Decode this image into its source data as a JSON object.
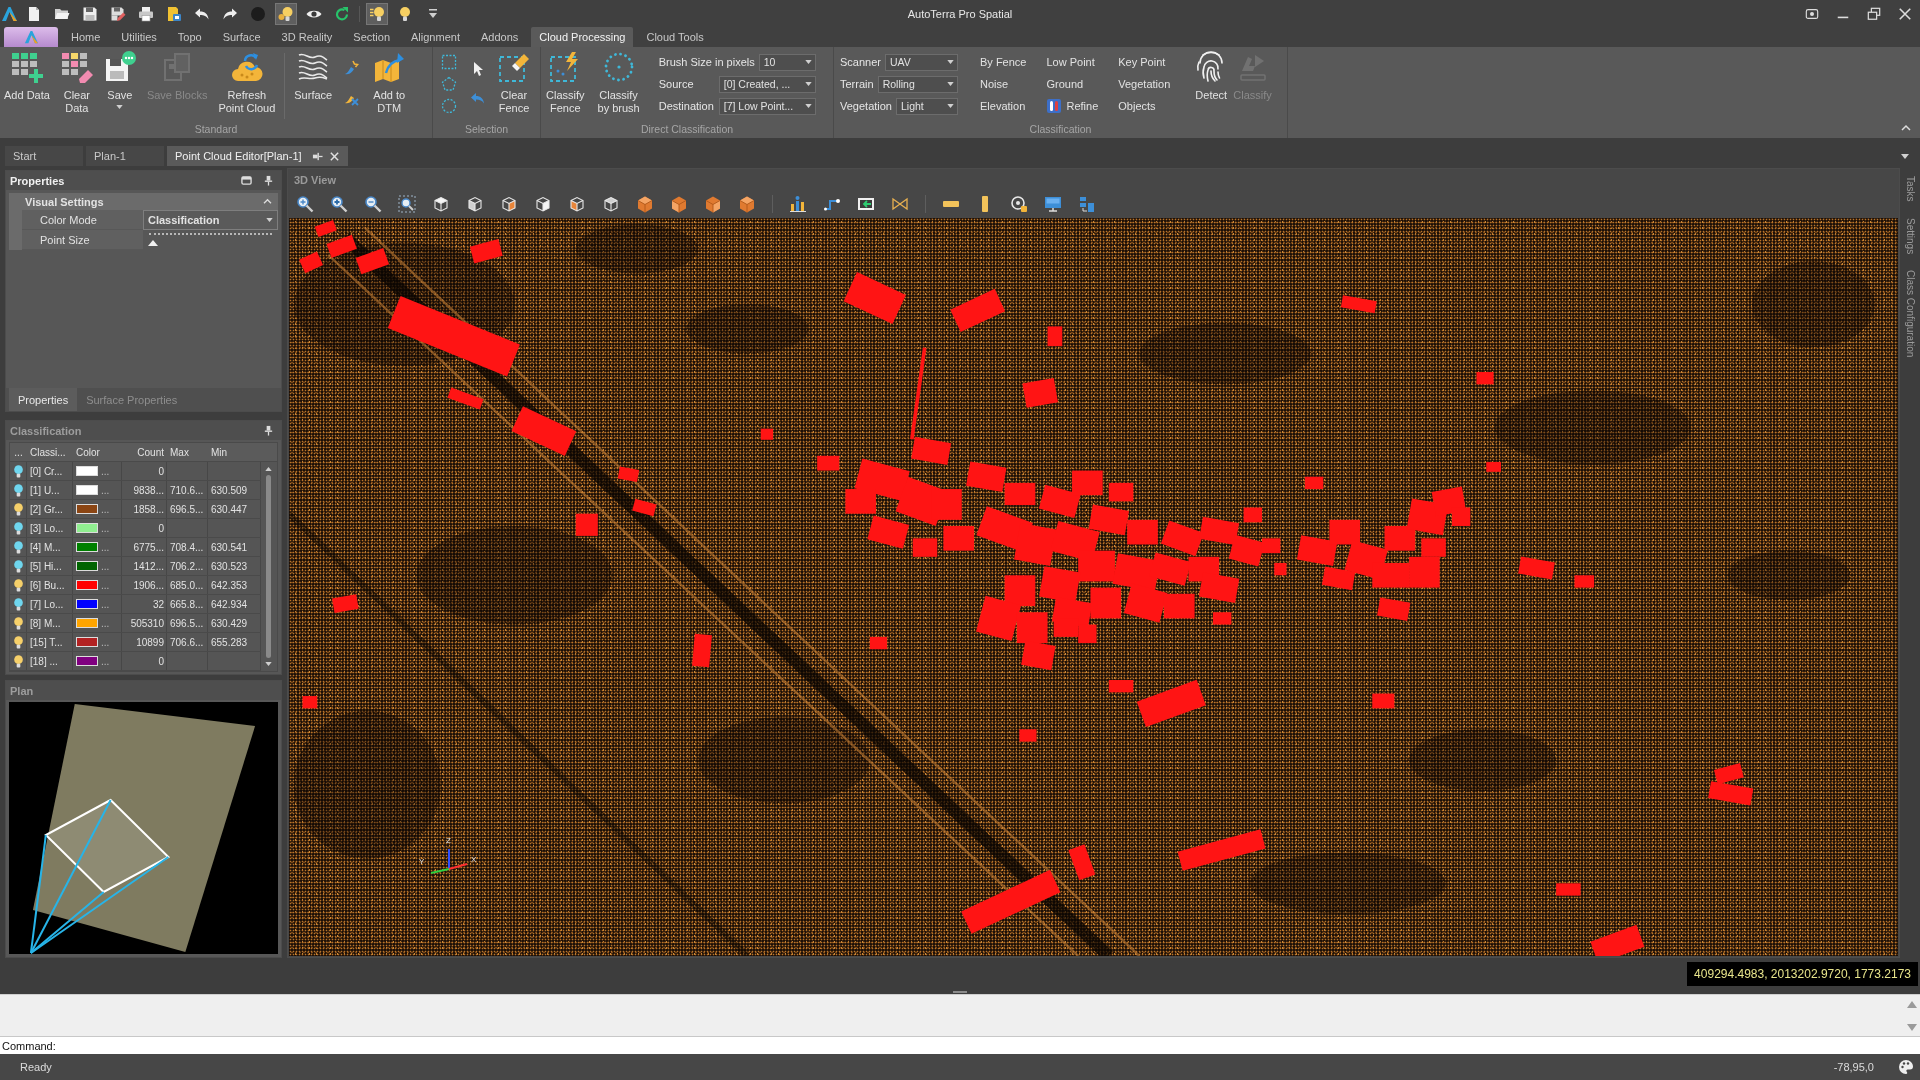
{
  "window": {
    "title": "AutoTerra Pro Spatial"
  },
  "quick_access": [
    {
      "on": false
    },
    {
      "on": false
    },
    {
      "on": false
    },
    {
      "on": false
    },
    {
      "on": false
    },
    {
      "on": false
    },
    {
      "on": false
    },
    {
      "on": false
    },
    {
      "on": false
    },
    {
      "on": true
    },
    {
      "on": false
    },
    {
      "on": false
    },
    {
      "on": true
    },
    {
      "on": false
    }
  ],
  "ribbon": {
    "tabs": [
      {
        "label": "Home",
        "selected": false
      },
      {
        "label": "Utilities",
        "selected": false
      },
      {
        "label": "Topo",
        "selected": false
      },
      {
        "label": "Surface",
        "selected": false
      },
      {
        "label": "3D Reality",
        "selected": false
      },
      {
        "label": "Section",
        "selected": false
      },
      {
        "label": "Alignment",
        "selected": false
      },
      {
        "label": "Addons",
        "selected": false
      },
      {
        "label": "Cloud Processing",
        "selected": true
      },
      {
        "label": "Cloud Tools",
        "selected": false
      }
    ],
    "groups": [
      {
        "title": "Standard",
        "buttons": [
          {
            "label": "Add Data",
            "disabled": false
          },
          {
            "label": "Clear\nData",
            "disabled": false
          },
          {
            "label": "Save",
            "disabled": false
          },
          {
            "label": "Save Blocks",
            "disabled": true
          },
          {
            "label": "Refresh\nPoint Cloud",
            "disabled": false
          },
          {
            "label": "Surface",
            "disabled": false
          },
          {
            "label": "Add to\nDTM",
            "disabled": false
          }
        ]
      },
      {
        "title": "Selection",
        "buttons": [
          {
            "label": "Clear\nFence",
            "disabled": false
          }
        ]
      },
      {
        "title": "Direct Classification",
        "buttons": [
          {
            "label": "Classify\nFence",
            "disabled": false
          },
          {
            "label": "Classify\nby brush",
            "disabled": false
          }
        ],
        "fields": [
          {
            "label": "Brush Size in pixels",
            "value": "10"
          },
          {
            "label": "Source",
            "value": "[0] Created, ..."
          },
          {
            "label": "Destination",
            "value": "[7] Low Point..."
          }
        ]
      },
      {
        "title": "Classification",
        "fields": [
          {
            "label": "Scanner",
            "value": "UAV"
          },
          {
            "label": "Terrain",
            "value": "Rolling"
          },
          {
            "label": "Vegetation",
            "value": "Light"
          }
        ],
        "commands": [
          {
            "kind": "plain",
            "label": "By Fence"
          },
          {
            "kind": "plain",
            "label": "Noise"
          },
          {
            "kind": "plain",
            "label": "Elevation"
          },
          {
            "kind": "plain",
            "label": "Low Point"
          },
          {
            "kind": "plain",
            "label": "Ground"
          },
          {
            "kind": "iconic",
            "label": "Refine"
          },
          {
            "kind": "plain",
            "label": "Key Point"
          },
          {
            "kind": "plain",
            "label": "Vegetation"
          },
          {
            "kind": "plain",
            "label": "Objects"
          }
        ],
        "buttons": [
          {
            "label": "Detect",
            "disabled": false
          },
          {
            "label": "Classify",
            "disabled": true
          }
        ]
      }
    ]
  },
  "doc_tabs": [
    {
      "label": "Start",
      "selected": false
    },
    {
      "label": "Plan-1",
      "selected": false
    },
    {
      "label": "Point Cloud Editor[Plan-1]",
      "selected": true
    }
  ],
  "properties_panel": {
    "title": "Properties",
    "section": {
      "title": "Visual Settings",
      "expanded": true
    },
    "rows": [
      {
        "kind": "dropdown",
        "label": "Color Mode",
        "value": "Classification"
      },
      {
        "kind": "slider",
        "label": "Point Size",
        "level": 0.03
      }
    ],
    "tabs": [
      {
        "label": "Properties",
        "selected": true
      },
      {
        "label": "Surface Properties",
        "selected": false
      }
    ]
  },
  "classification_panel": {
    "title": "Classification",
    "columns": [
      "...",
      "Classi...",
      "Color",
      "Count",
      "Max",
      "Min"
    ],
    "rows": [
      {
        "visible": false,
        "name": "[0] Cr...",
        "color": "#ffffff",
        "color_more": "...",
        "count": "0"
      },
      {
        "visible": false,
        "name": "[1] U...",
        "color": "#ffffff",
        "color_more": "...",
        "count": "9838...",
        "max": "710.6...",
        "min": "630.509"
      },
      {
        "visible": true,
        "name": "[2] Gr...",
        "color": "#8b4513",
        "color_more": "...",
        "count": "1858...",
        "max": "696.5...",
        "min": "630.447"
      },
      {
        "visible": false,
        "name": "[3] Lo...",
        "color": "#90ee90",
        "color_more": "...",
        "count": "0"
      },
      {
        "visible": false,
        "name": "[4] M...",
        "color": "#008000",
        "color_more": "...",
        "count": "6775...",
        "max": "708.4...",
        "min": "630.541"
      },
      {
        "visible": false,
        "name": "[5] Hi...",
        "color": "#006400",
        "color_more": "...",
        "count": "1412...",
        "max": "706.2...",
        "min": "630.523"
      },
      {
        "visible": true,
        "name": "[6] Bu...",
        "color": "#ff0000",
        "color_more": "...",
        "count": "1906...",
        "max": "685.0...",
        "min": "642.353"
      },
      {
        "visible": false,
        "name": "[7] Lo...",
        "color": "#0000ff",
        "color_more": "...",
        "count": "32",
        "max": "665.8...",
        "min": "642.934"
      },
      {
        "visible": true,
        "name": "[8] M...",
        "color": "#ffa500",
        "color_more": "...",
        "count": "505310",
        "max": "696.5...",
        "min": "630.429"
      },
      {
        "visible": true,
        "name": "[15] T...",
        "color": "#b22222",
        "color_more": "...",
        "count": "10899",
        "max": "706.6...",
        "min": "655.283"
      },
      {
        "visible": true,
        "name": "[18] ...",
        "color": "#800080",
        "color_more": "...",
        "count": "0"
      }
    ]
  },
  "plan_panel": {
    "title": "Plan"
  },
  "view": {
    "title": "3D View",
    "axis_labels": [
      "Y",
      "Z",
      "X"
    ],
    "coordinates": "409294.4983, 2013202.9720, 1773.2173"
  },
  "side_tabs": [
    "Tasks",
    "Settings",
    "Class Configuration"
  ],
  "command": {
    "label": "Command:"
  },
  "status_bar": {
    "message": "Ready",
    "readout": "-78,95,0"
  }
}
